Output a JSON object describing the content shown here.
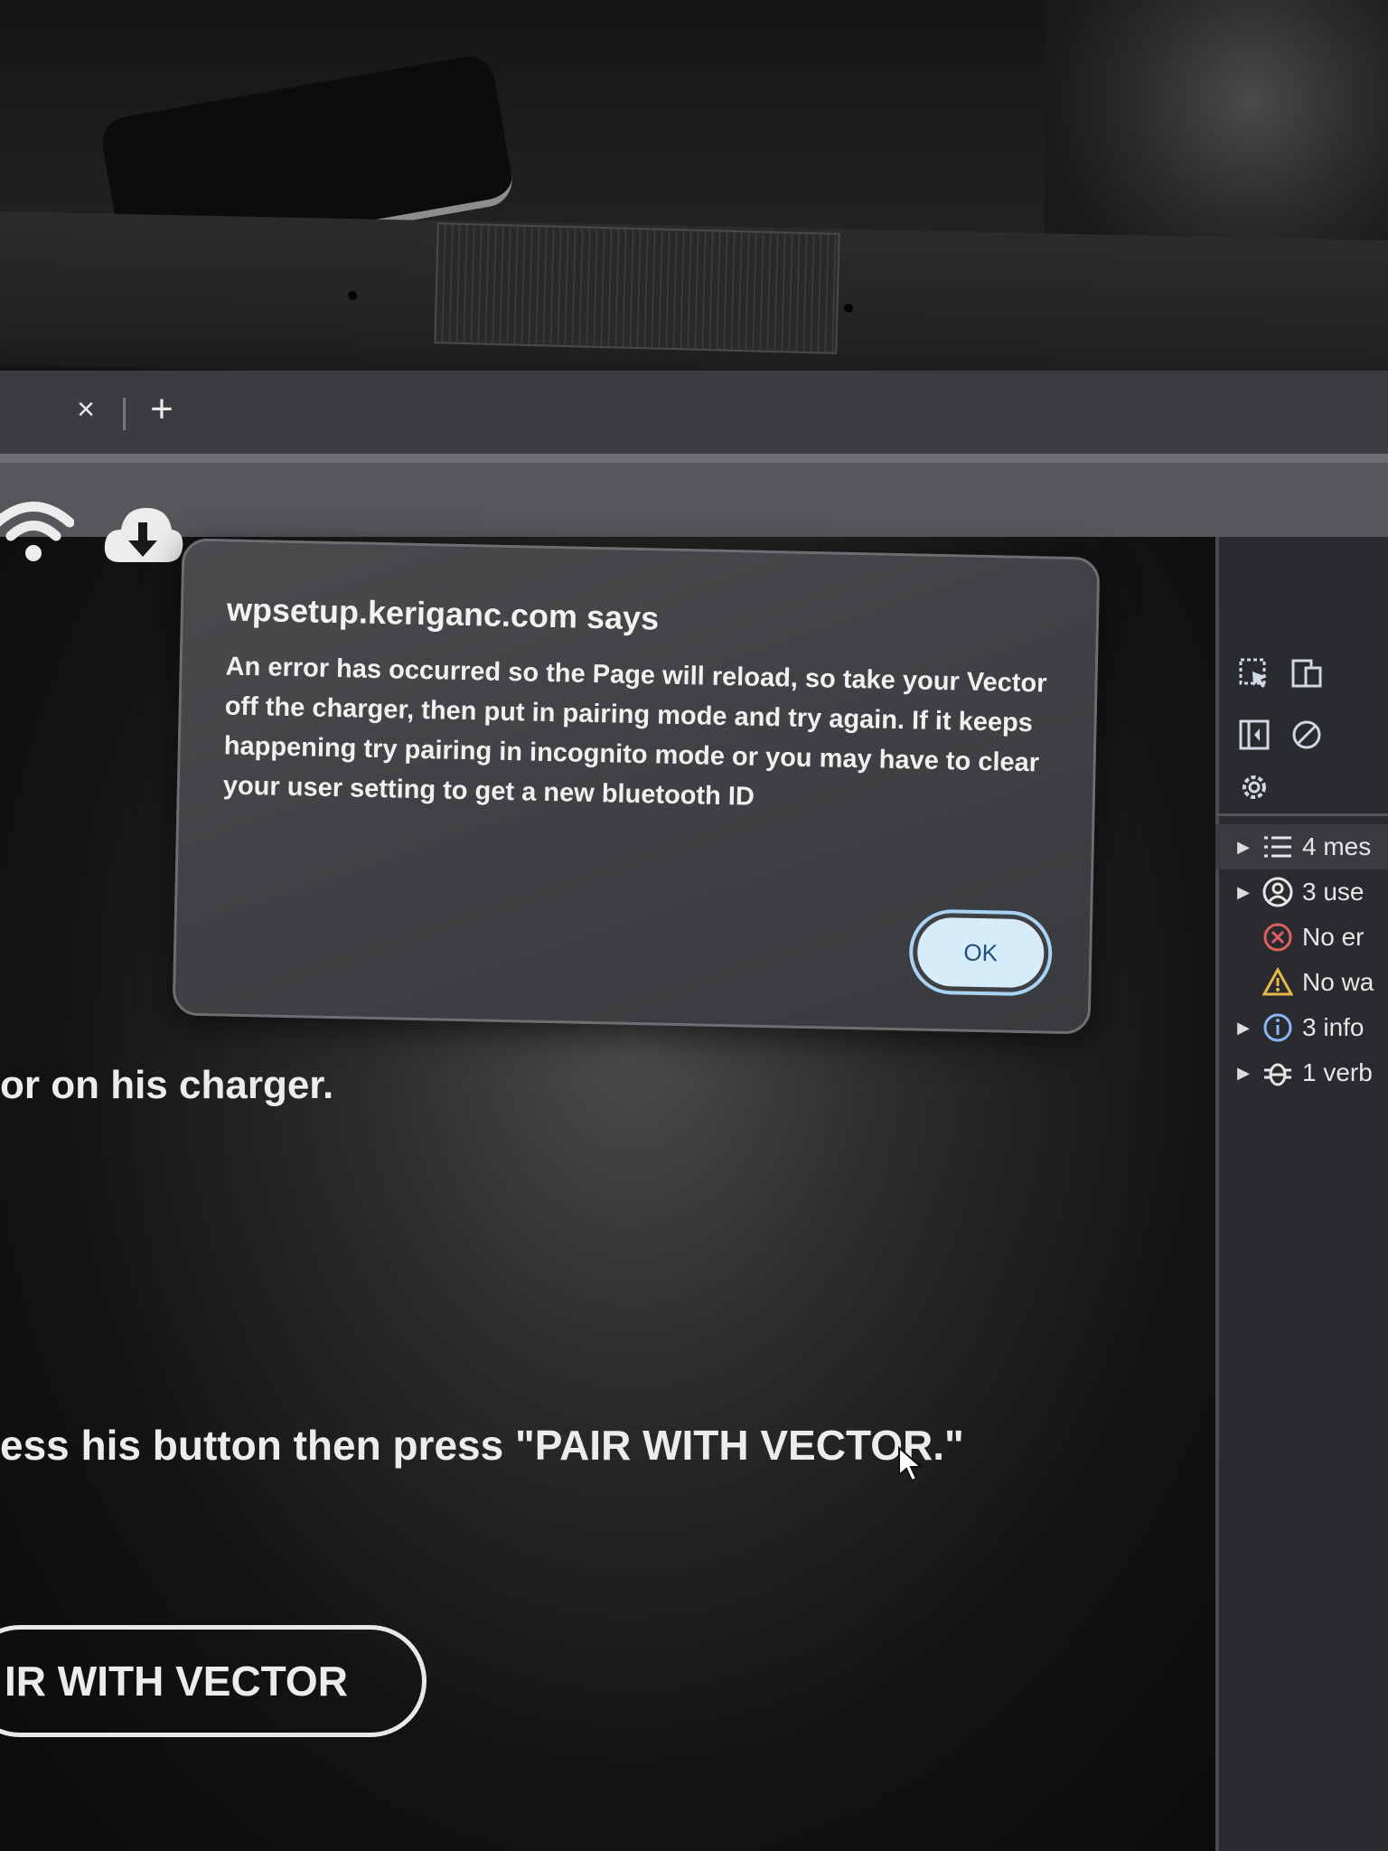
{
  "browser": {
    "tab_close_glyph": "×",
    "new_tab_glyph": "+"
  },
  "dialog": {
    "title": "wpsetup.keriganc.com says",
    "message": "An error has occurred so the Page will reload, so take your Vector off the charger, then put in pairing mode and try again. If it keeps happening try pairing in incognito mode or you may have to clear your user setting to get a new bluetooth ID",
    "ok_label": "OK"
  },
  "page": {
    "icons": [
      "wifi-icon",
      "download-icon"
    ],
    "line1": "or on his charger.",
    "line2": "ess his button then press \"PAIR WITH VECTOR.\"",
    "pair_button_label": "IR WITH VECTOR"
  },
  "devtools": {
    "toolbar_icons": [
      "inspect-element-icon",
      "device-toolbar-icon",
      "sidebar-toggle-icon",
      "clear-console-icon",
      "settings-icon"
    ],
    "console_items": [
      {
        "icon": "list-icon",
        "label": "4 mes",
        "expandable": true
      },
      {
        "icon": "user-icon",
        "label": "3 use",
        "expandable": true
      },
      {
        "icon": "error-icon",
        "label": "No er",
        "expandable": false
      },
      {
        "icon": "warning-icon",
        "label": "No wa",
        "expandable": false
      },
      {
        "icon": "info-icon",
        "label": "3 info",
        "expandable": true
      },
      {
        "icon": "bug-icon",
        "label": "1 verb",
        "expandable": true
      }
    ]
  },
  "colors": {
    "dialog_bg": "#3f4043",
    "ok_button_bg": "#d6ecfb",
    "ok_button_text": "#1f4f7c",
    "error_red": "#e06060",
    "warning_yellow": "#e8b84a",
    "info_blue": "#8ab4f8"
  }
}
